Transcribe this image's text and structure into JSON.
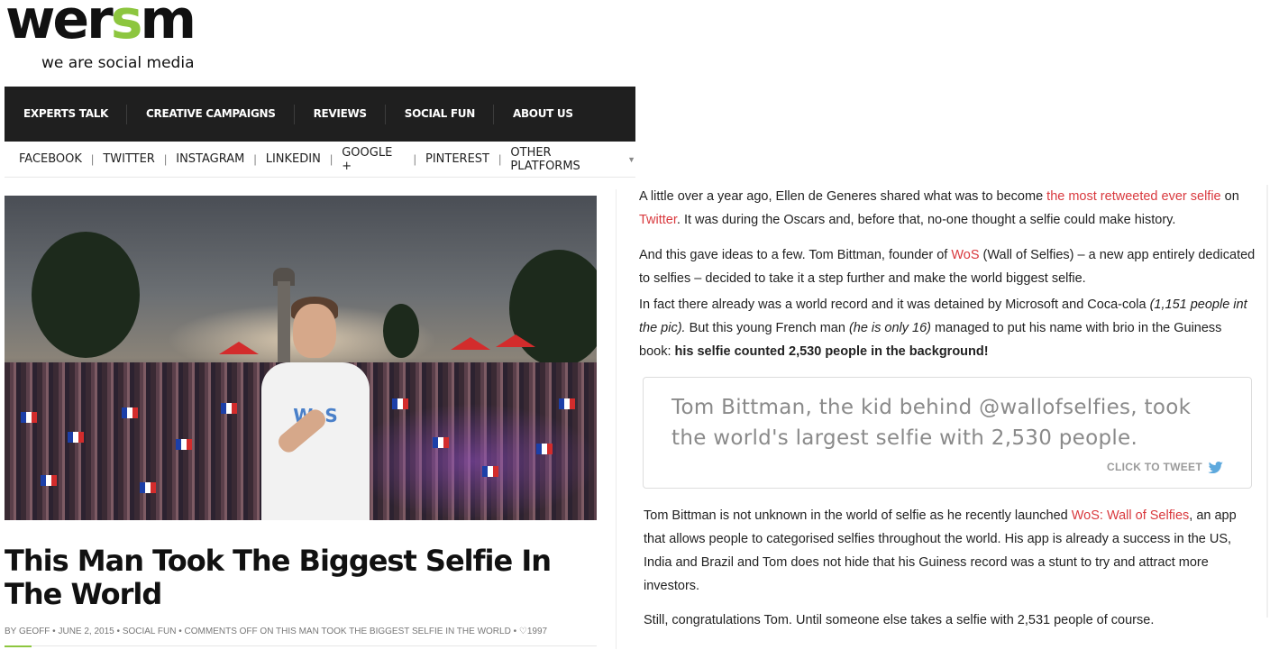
{
  "logo": {
    "word_start": "wer",
    "word_accent": "s",
    "word_end": "m",
    "tagline": "we are social media",
    "accent_color": "#8dc63f"
  },
  "main_nav": [
    "EXPERTS TALK",
    "CREATIVE CAMPAIGNS",
    "REVIEWS",
    "SOCIAL FUN",
    "ABOUT US"
  ],
  "sub_nav": {
    "items": [
      "FACEBOOK",
      "TWITTER",
      "INSTAGRAM",
      "LINKEDIN",
      "GOOGLE +",
      "PINTEREST",
      "OTHER PLATFORMS"
    ],
    "separator": "|",
    "dropdown_icon": "chevron-down-icon"
  },
  "hero": {
    "shirt_logo": "WoS"
  },
  "article": {
    "title": "This Man Took The Biggest Selfie In The World",
    "meta": {
      "author": "BY GEOFF",
      "date": "JUNE 2, 2015",
      "category": "SOCIAL FUN",
      "comments": "COMMENTS OFF ON THIS MAN TOOK THE BIGGEST SELFIE IN THE WORLD",
      "likes": "1997",
      "dot": "•",
      "heart_icon": "heart-icon"
    },
    "p1": {
      "a": "A little over a year ago, Ellen de Generes shared what was to become ",
      "link1": "the most retweeted ever selfie",
      "b": " on ",
      "link2": "Twitter",
      "c": ". It was during the Oscars and, before that, no-one thought a selfie could make history."
    },
    "p2": {
      "a": "And this gave ideas to a few. Tom Bittman, founder of ",
      "link": "WoS",
      "b": " (Wall of Selfies) – a new app entirely dedicated to selfies – decided to take it a step further and make the world biggest selfie."
    },
    "p3": {
      "a": "In fact there already was a world record and it was detained by Microsoft and Coca-cola ",
      "em1": "(1,151 people int the pic).",
      "b": " But this young French man ",
      "em2": "(he is only 16)",
      "c": " managed to put his name with brio in the Guiness book: ",
      "strong": "his selfie counted  2,530 people in the background!"
    },
    "tweet": {
      "text": "Tom Bittman, the kid behind @wallofselfies, took the world's largest selfie with 2,530 people.",
      "cta": "CLICK TO TWEET",
      "icon": "twitter-bird-icon",
      "icon_color": "#5ea9dd"
    },
    "p4": {
      "a": "Tom Bittman is not unknown in the world of selfie as he recently launched ",
      "link": "WoS: Wall of Selfies",
      "b": ", an app that allows people to categorised selfies throughout the world. His app is already a success in the US, India and Brazil and Tom does not hide that his Guiness record was a stunt to try and attract more investors."
    },
    "p5": "Still, congratulations Tom. Until someone else takes a selfie with 2,531 people of course.",
    "link_color": "#d9393e"
  }
}
